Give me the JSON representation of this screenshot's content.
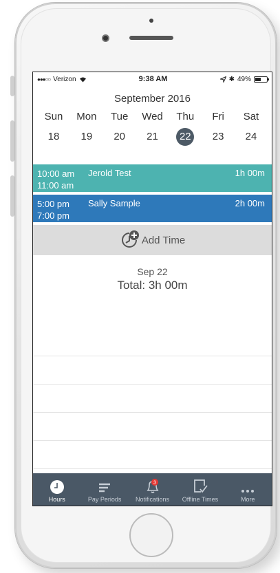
{
  "status_bar": {
    "carrier": "Verizon",
    "time": "9:38 AM",
    "battery": "49%",
    "battery_level": 0.49
  },
  "calendar": {
    "month": "September 2016",
    "days": [
      "Sun",
      "Mon",
      "Tue",
      "Wed",
      "Thu",
      "Fri",
      "Sat"
    ],
    "dates": [
      "18",
      "19",
      "20",
      "21",
      "22",
      "23",
      "24"
    ],
    "selected_date": "22"
  },
  "entries": [
    {
      "start": "10:00 am",
      "end": "11:00 am",
      "name": "Jerold Test",
      "duration": "1h 00m",
      "color": "#4db3b0"
    },
    {
      "start": "5:00 pm",
      "end": "7:00 pm",
      "name": "Sally Sample",
      "duration": "2h 00m",
      "color": "#2e79ba"
    }
  ],
  "add_time": {
    "label": "Add Time",
    "icon": "add-clock-icon"
  },
  "summary": {
    "date": "Sep 22",
    "total": "Total: 3h 00m"
  },
  "tabs": [
    {
      "label": "Hours",
      "icon": "clock-icon",
      "active": true
    },
    {
      "label": "Pay Periods",
      "icon": "lines-icon",
      "active": false
    },
    {
      "label": "Notifications",
      "icon": "bell-icon",
      "badge": "3",
      "active": false
    },
    {
      "label": "Offline Times",
      "icon": "offline-check-icon",
      "active": false
    },
    {
      "label": "More",
      "icon": "more-dots-icon",
      "active": false
    }
  ],
  "colors": {
    "tabbar": "#4a5866",
    "selected_date": "#4d5a66",
    "badge": "#e53935"
  }
}
